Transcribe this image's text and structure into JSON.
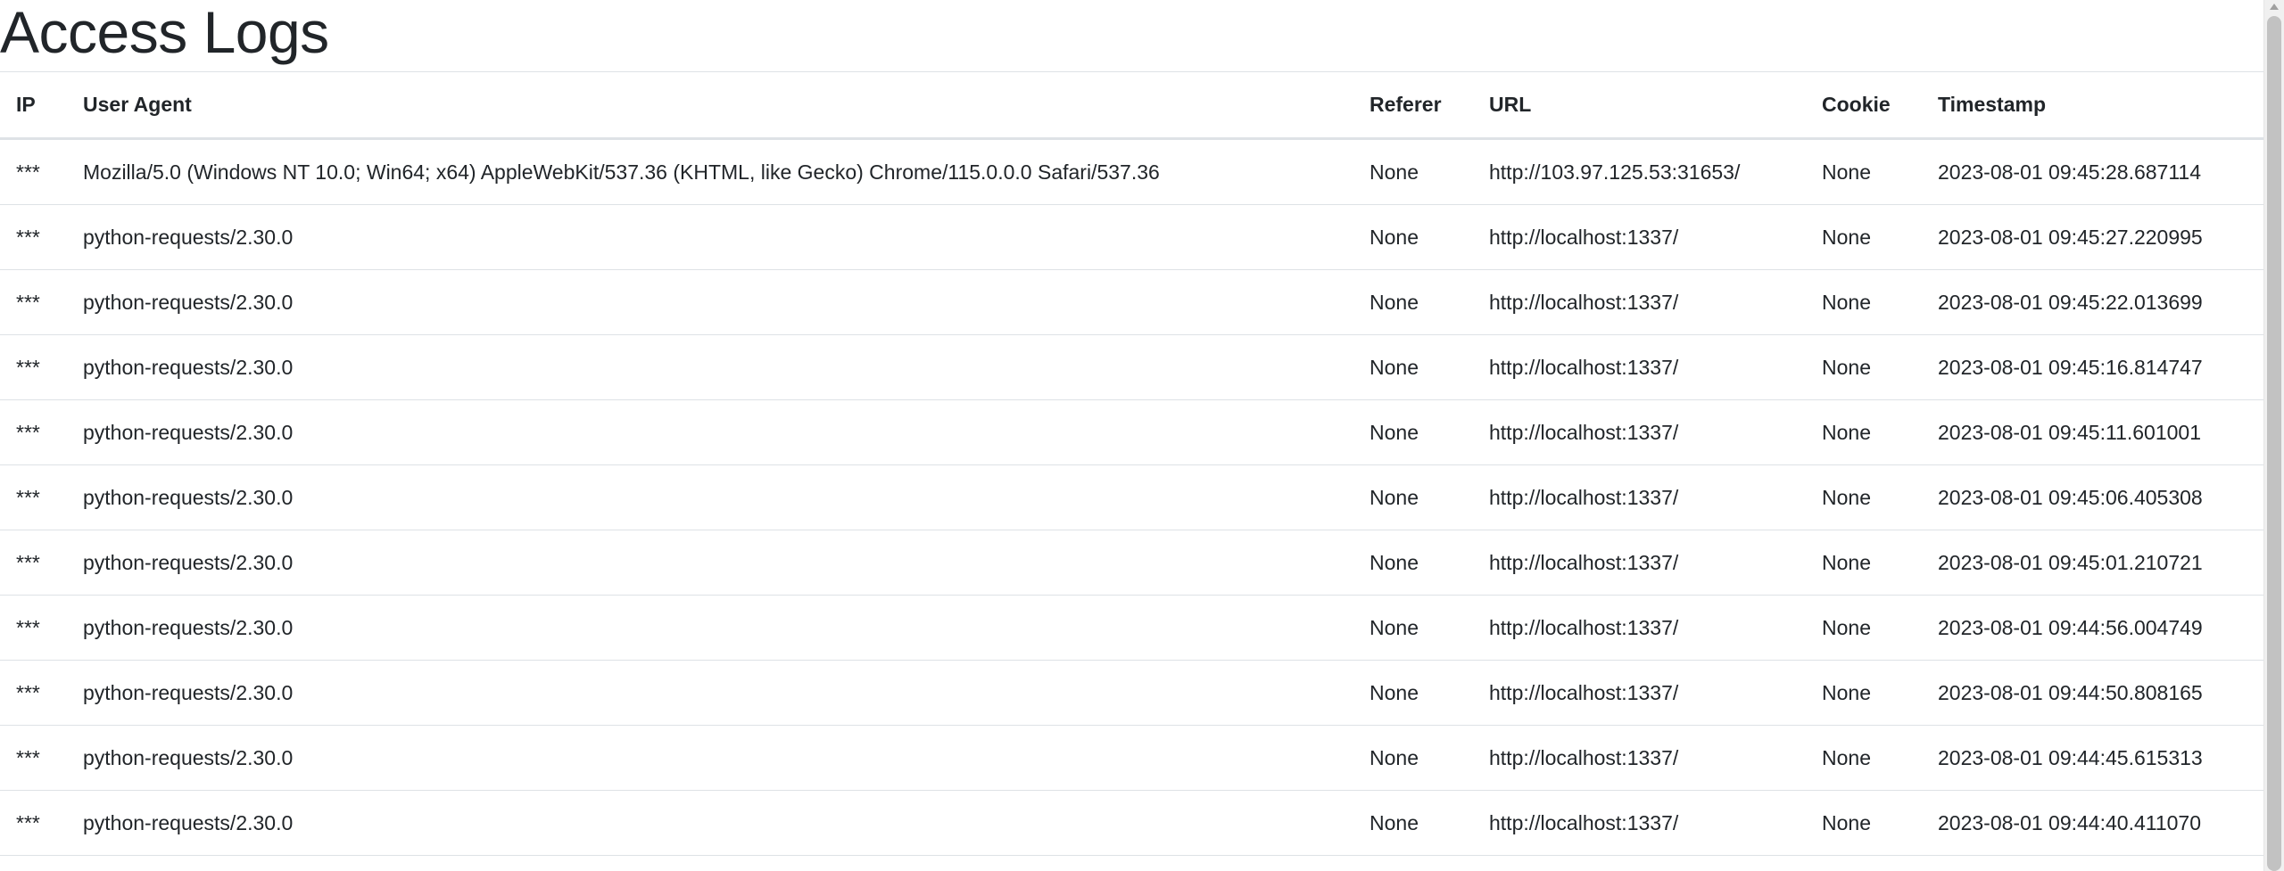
{
  "page_title": "Access Logs",
  "table": {
    "headers": {
      "ip": "IP",
      "user_agent": "User Agent",
      "referer": "Referer",
      "url": "URL",
      "cookie": "Cookie",
      "timestamp": "Timestamp"
    },
    "rows": [
      {
        "ip": "***",
        "user_agent": "Mozilla/5.0 (Windows NT 10.0; Win64; x64) AppleWebKit/537.36 (KHTML, like Gecko) Chrome/115.0.0.0 Safari/537.36",
        "referer": "None",
        "url": "http://103.97.125.53:31653/",
        "cookie": "None",
        "timestamp": "2023-08-01 09:45:28.687114"
      },
      {
        "ip": "***",
        "user_agent": "python-requests/2.30.0",
        "referer": "None",
        "url": "http://localhost:1337/",
        "cookie": "None",
        "timestamp": "2023-08-01 09:45:27.220995"
      },
      {
        "ip": "***",
        "user_agent": "python-requests/2.30.0",
        "referer": "None",
        "url": "http://localhost:1337/",
        "cookie": "None",
        "timestamp": "2023-08-01 09:45:22.013699"
      },
      {
        "ip": "***",
        "user_agent": "python-requests/2.30.0",
        "referer": "None",
        "url": "http://localhost:1337/",
        "cookie": "None",
        "timestamp": "2023-08-01 09:45:16.814747"
      },
      {
        "ip": "***",
        "user_agent": "python-requests/2.30.0",
        "referer": "None",
        "url": "http://localhost:1337/",
        "cookie": "None",
        "timestamp": "2023-08-01 09:45:11.601001"
      },
      {
        "ip": "***",
        "user_agent": "python-requests/2.30.0",
        "referer": "None",
        "url": "http://localhost:1337/",
        "cookie": "None",
        "timestamp": "2023-08-01 09:45:06.405308"
      },
      {
        "ip": "***",
        "user_agent": "python-requests/2.30.0",
        "referer": "None",
        "url": "http://localhost:1337/",
        "cookie": "None",
        "timestamp": "2023-08-01 09:45:01.210721"
      },
      {
        "ip": "***",
        "user_agent": "python-requests/2.30.0",
        "referer": "None",
        "url": "http://localhost:1337/",
        "cookie": "None",
        "timestamp": "2023-08-01 09:44:56.004749"
      },
      {
        "ip": "***",
        "user_agent": "python-requests/2.30.0",
        "referer": "None",
        "url": "http://localhost:1337/",
        "cookie": "None",
        "timestamp": "2023-08-01 09:44:50.808165"
      },
      {
        "ip": "***",
        "user_agent": "python-requests/2.30.0",
        "referer": "None",
        "url": "http://localhost:1337/",
        "cookie": "None",
        "timestamp": "2023-08-01 09:44:45.615313"
      },
      {
        "ip": "***",
        "user_agent": "python-requests/2.30.0",
        "referer": "None",
        "url": "http://localhost:1337/",
        "cookie": "None",
        "timestamp": "2023-08-01 09:44:40.411070"
      }
    ]
  },
  "colors": {
    "text": "#212529",
    "border": "#dee2e6",
    "background": "#ffffff",
    "scrollbar_thumb": "#c2c2c2"
  }
}
